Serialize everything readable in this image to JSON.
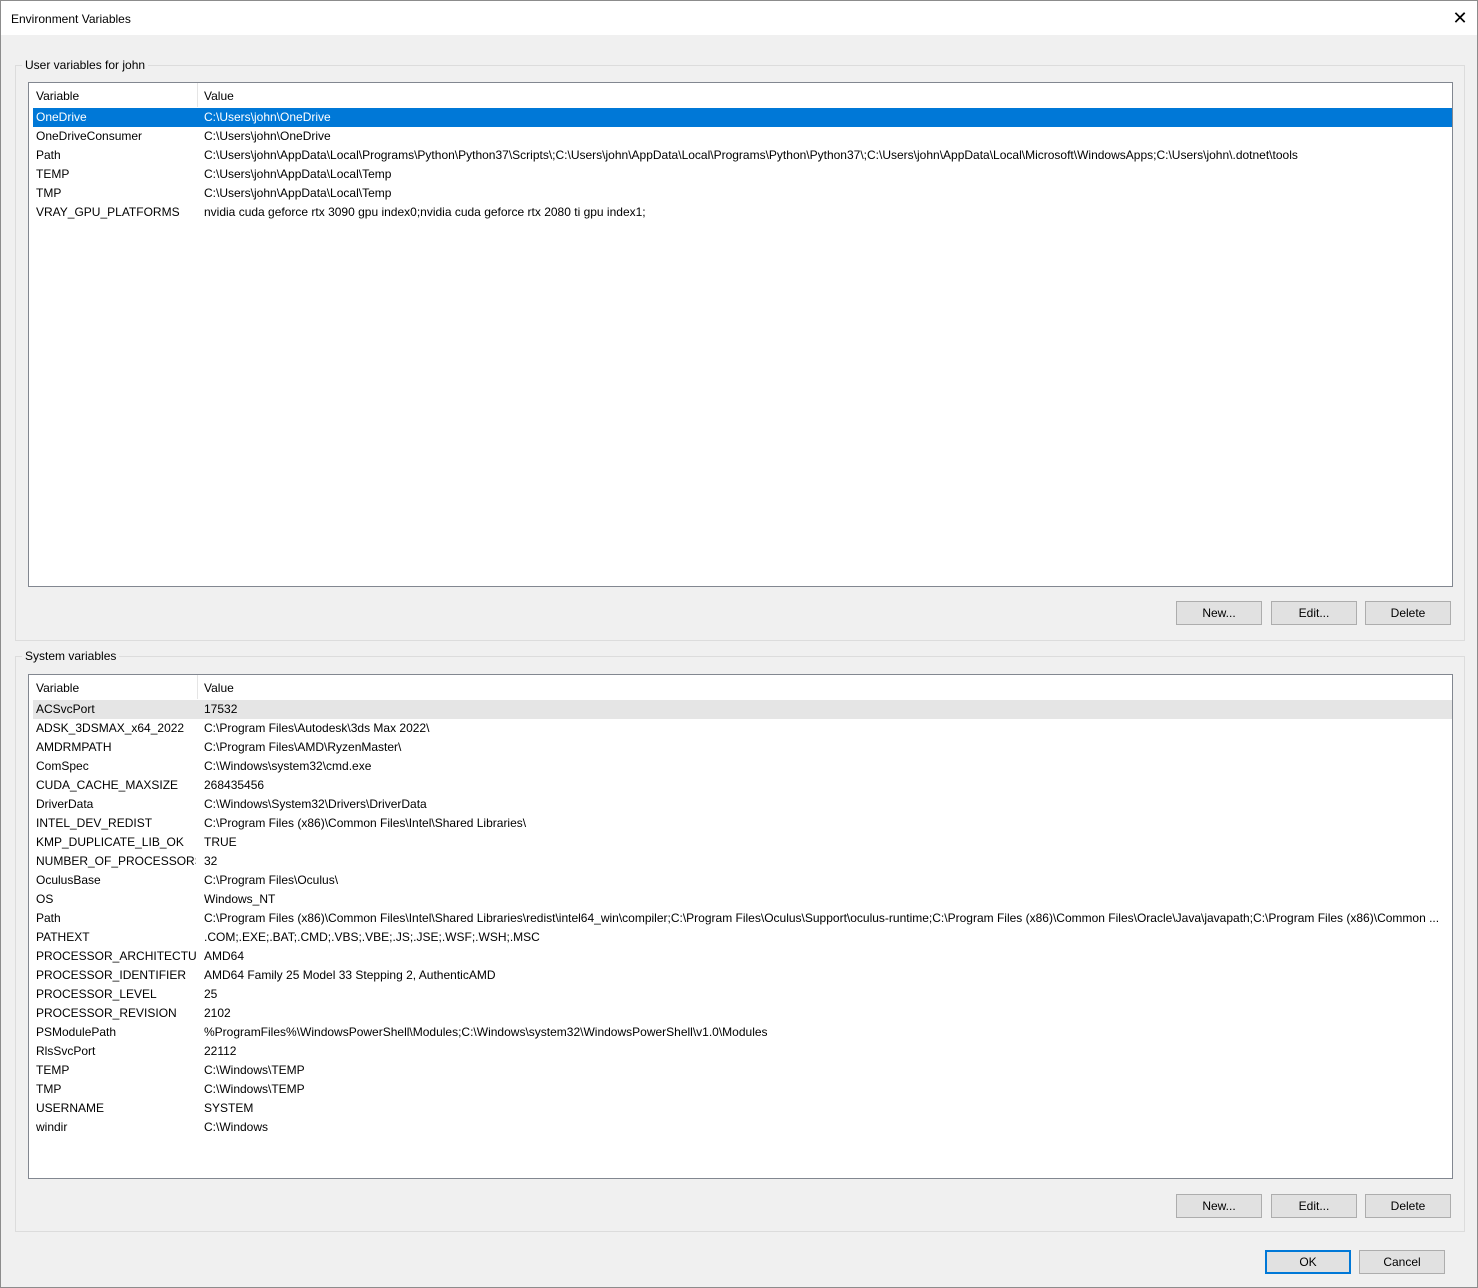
{
  "window": {
    "title": "Environment Variables",
    "close_glyph": "✕"
  },
  "user_section": {
    "label": "User variables for john",
    "columns": {
      "variable": "Variable",
      "value": "Value"
    },
    "rows": [
      {
        "name": "OneDrive",
        "value": "C:\\Users\\john\\OneDrive"
      },
      {
        "name": "OneDriveConsumer",
        "value": "C:\\Users\\john\\OneDrive"
      },
      {
        "name": "Path",
        "value": "C:\\Users\\john\\AppData\\Local\\Programs\\Python\\Python37\\Scripts\\;C:\\Users\\john\\AppData\\Local\\Programs\\Python\\Python37\\;C:\\Users\\john\\AppData\\Local\\Microsoft\\WindowsApps;C:\\Users\\john\\.dotnet\\tools"
      },
      {
        "name": "TEMP",
        "value": "C:\\Users\\john\\AppData\\Local\\Temp"
      },
      {
        "name": "TMP",
        "value": "C:\\Users\\john\\AppData\\Local\\Temp"
      },
      {
        "name": "VRAY_GPU_PLATFORMS",
        "value": "nvidia cuda geforce rtx 3090 gpu index0;nvidia cuda geforce rtx 2080 ti gpu index1;"
      }
    ],
    "buttons": {
      "new": "New...",
      "edit": "Edit...",
      "delete": "Delete"
    }
  },
  "system_section": {
    "label": "System variables",
    "columns": {
      "variable": "Variable",
      "value": "Value"
    },
    "rows": [
      {
        "name": "ACSvcPort",
        "value": "17532"
      },
      {
        "name": "ADSK_3DSMAX_x64_2022",
        "value": "C:\\Program Files\\Autodesk\\3ds Max 2022\\"
      },
      {
        "name": "AMDRMPATH",
        "value": "C:\\Program Files\\AMD\\RyzenMaster\\"
      },
      {
        "name": "ComSpec",
        "value": "C:\\Windows\\system32\\cmd.exe"
      },
      {
        "name": "CUDA_CACHE_MAXSIZE",
        "value": "268435456"
      },
      {
        "name": "DriverData",
        "value": "C:\\Windows\\System32\\Drivers\\DriverData"
      },
      {
        "name": "INTEL_DEV_REDIST",
        "value": "C:\\Program Files (x86)\\Common Files\\Intel\\Shared Libraries\\"
      },
      {
        "name": "KMP_DUPLICATE_LIB_OK",
        "value": "TRUE"
      },
      {
        "name": "NUMBER_OF_PROCESSORS",
        "value": "32"
      },
      {
        "name": "OculusBase",
        "value": "C:\\Program Files\\Oculus\\"
      },
      {
        "name": "OS",
        "value": "Windows_NT"
      },
      {
        "name": "Path",
        "value": "C:\\Program Files (x86)\\Common Files\\Intel\\Shared Libraries\\redist\\intel64_win\\compiler;C:\\Program Files\\Oculus\\Support\\oculus-runtime;C:\\Program Files (x86)\\Common Files\\Oracle\\Java\\javapath;C:\\Program Files (x86)\\Common ..."
      },
      {
        "name": "PATHEXT",
        "value": ".COM;.EXE;.BAT;.CMD;.VBS;.VBE;.JS;.JSE;.WSF;.WSH;.MSC"
      },
      {
        "name": "PROCESSOR_ARCHITECTURE",
        "value": "AMD64"
      },
      {
        "name": "PROCESSOR_IDENTIFIER",
        "value": "AMD64 Family 25 Model 33 Stepping 2, AuthenticAMD"
      },
      {
        "name": "PROCESSOR_LEVEL",
        "value": "25"
      },
      {
        "name": "PROCESSOR_REVISION",
        "value": "2102"
      },
      {
        "name": "PSModulePath",
        "value": "%ProgramFiles%\\WindowsPowerShell\\Modules;C:\\Windows\\system32\\WindowsPowerShell\\v1.0\\Modules"
      },
      {
        "name": "RlsSvcPort",
        "value": "22112"
      },
      {
        "name": "TEMP",
        "value": "C:\\Windows\\TEMP"
      },
      {
        "name": "TMP",
        "value": "C:\\Windows\\TEMP"
      },
      {
        "name": "USERNAME",
        "value": "SYSTEM"
      },
      {
        "name": "windir",
        "value": "C:\\Windows"
      }
    ],
    "buttons": {
      "new": "New...",
      "edit": "Edit...",
      "delete": "Delete"
    }
  },
  "footer": {
    "ok": "OK",
    "cancel": "Cancel"
  },
  "colors": {
    "selection": "#0078d7",
    "hover": "#e5e5e5",
    "dialog_bg": "#f0f0f0"
  }
}
